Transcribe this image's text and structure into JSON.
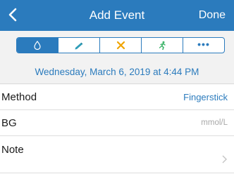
{
  "header": {
    "title": "Add Event",
    "done_label": "Done"
  },
  "event_types": [
    {
      "icon": "blood-drop-icon",
      "selected": true
    },
    {
      "icon": "pen-icon",
      "selected": false
    },
    {
      "icon": "fork-knife-icon",
      "selected": false
    },
    {
      "icon": "exercise-icon",
      "selected": false
    },
    {
      "icon": "more-icon",
      "label": "•••",
      "selected": false
    }
  ],
  "event_datetime": "Wednesday, March 6, 2019 at 4:44 PM",
  "fields": {
    "method": {
      "label": "Method",
      "value": "Fingerstick"
    },
    "bg": {
      "label": "BG",
      "placeholder": "mmol/L"
    },
    "note": {
      "label": "Note"
    }
  },
  "colors": {
    "accent": "#2b7bbd",
    "icon_pen": "#2f9db8",
    "icon_food": "#f0a400",
    "icon_exercise": "#3fb56b"
  }
}
